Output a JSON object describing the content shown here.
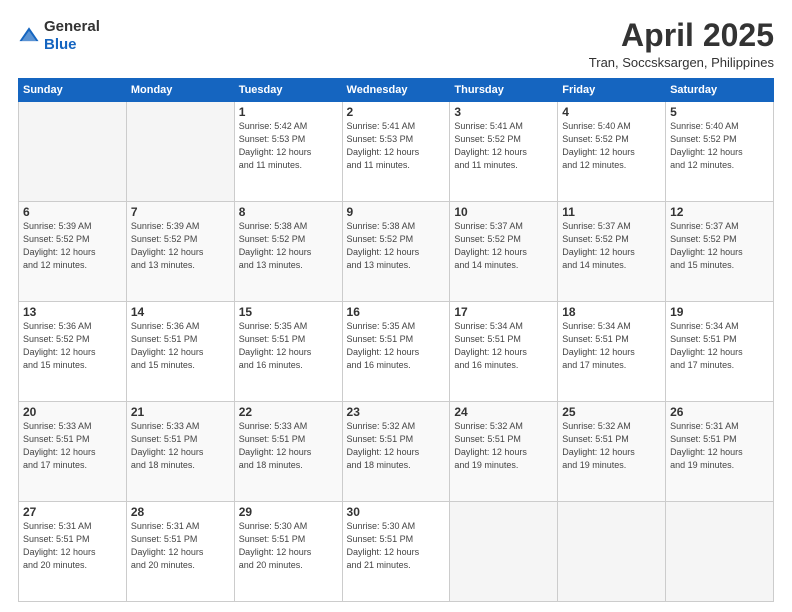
{
  "logo": {
    "general": "General",
    "blue": "Blue"
  },
  "title": "April 2025",
  "subtitle": "Tran, Soccsksargen, Philippines",
  "days_header": [
    "Sunday",
    "Monday",
    "Tuesday",
    "Wednesday",
    "Thursday",
    "Friday",
    "Saturday"
  ],
  "weeks": [
    [
      {
        "day": "",
        "info": ""
      },
      {
        "day": "",
        "info": ""
      },
      {
        "day": "1",
        "info": "Sunrise: 5:42 AM\nSunset: 5:53 PM\nDaylight: 12 hours\nand 11 minutes."
      },
      {
        "day": "2",
        "info": "Sunrise: 5:41 AM\nSunset: 5:53 PM\nDaylight: 12 hours\nand 11 minutes."
      },
      {
        "day": "3",
        "info": "Sunrise: 5:41 AM\nSunset: 5:52 PM\nDaylight: 12 hours\nand 11 minutes."
      },
      {
        "day": "4",
        "info": "Sunrise: 5:40 AM\nSunset: 5:52 PM\nDaylight: 12 hours\nand 12 minutes."
      },
      {
        "day": "5",
        "info": "Sunrise: 5:40 AM\nSunset: 5:52 PM\nDaylight: 12 hours\nand 12 minutes."
      }
    ],
    [
      {
        "day": "6",
        "info": "Sunrise: 5:39 AM\nSunset: 5:52 PM\nDaylight: 12 hours\nand 12 minutes."
      },
      {
        "day": "7",
        "info": "Sunrise: 5:39 AM\nSunset: 5:52 PM\nDaylight: 12 hours\nand 13 minutes."
      },
      {
        "day": "8",
        "info": "Sunrise: 5:38 AM\nSunset: 5:52 PM\nDaylight: 12 hours\nand 13 minutes."
      },
      {
        "day": "9",
        "info": "Sunrise: 5:38 AM\nSunset: 5:52 PM\nDaylight: 12 hours\nand 13 minutes."
      },
      {
        "day": "10",
        "info": "Sunrise: 5:37 AM\nSunset: 5:52 PM\nDaylight: 12 hours\nand 14 minutes."
      },
      {
        "day": "11",
        "info": "Sunrise: 5:37 AM\nSunset: 5:52 PM\nDaylight: 12 hours\nand 14 minutes."
      },
      {
        "day": "12",
        "info": "Sunrise: 5:37 AM\nSunset: 5:52 PM\nDaylight: 12 hours\nand 15 minutes."
      }
    ],
    [
      {
        "day": "13",
        "info": "Sunrise: 5:36 AM\nSunset: 5:52 PM\nDaylight: 12 hours\nand 15 minutes."
      },
      {
        "day": "14",
        "info": "Sunrise: 5:36 AM\nSunset: 5:51 PM\nDaylight: 12 hours\nand 15 minutes."
      },
      {
        "day": "15",
        "info": "Sunrise: 5:35 AM\nSunset: 5:51 PM\nDaylight: 12 hours\nand 16 minutes."
      },
      {
        "day": "16",
        "info": "Sunrise: 5:35 AM\nSunset: 5:51 PM\nDaylight: 12 hours\nand 16 minutes."
      },
      {
        "day": "17",
        "info": "Sunrise: 5:34 AM\nSunset: 5:51 PM\nDaylight: 12 hours\nand 16 minutes."
      },
      {
        "day": "18",
        "info": "Sunrise: 5:34 AM\nSunset: 5:51 PM\nDaylight: 12 hours\nand 17 minutes."
      },
      {
        "day": "19",
        "info": "Sunrise: 5:34 AM\nSunset: 5:51 PM\nDaylight: 12 hours\nand 17 minutes."
      }
    ],
    [
      {
        "day": "20",
        "info": "Sunrise: 5:33 AM\nSunset: 5:51 PM\nDaylight: 12 hours\nand 17 minutes."
      },
      {
        "day": "21",
        "info": "Sunrise: 5:33 AM\nSunset: 5:51 PM\nDaylight: 12 hours\nand 18 minutes."
      },
      {
        "day": "22",
        "info": "Sunrise: 5:33 AM\nSunset: 5:51 PM\nDaylight: 12 hours\nand 18 minutes."
      },
      {
        "day": "23",
        "info": "Sunrise: 5:32 AM\nSunset: 5:51 PM\nDaylight: 12 hours\nand 18 minutes."
      },
      {
        "day": "24",
        "info": "Sunrise: 5:32 AM\nSunset: 5:51 PM\nDaylight: 12 hours\nand 19 minutes."
      },
      {
        "day": "25",
        "info": "Sunrise: 5:32 AM\nSunset: 5:51 PM\nDaylight: 12 hours\nand 19 minutes."
      },
      {
        "day": "26",
        "info": "Sunrise: 5:31 AM\nSunset: 5:51 PM\nDaylight: 12 hours\nand 19 minutes."
      }
    ],
    [
      {
        "day": "27",
        "info": "Sunrise: 5:31 AM\nSunset: 5:51 PM\nDaylight: 12 hours\nand 20 minutes."
      },
      {
        "day": "28",
        "info": "Sunrise: 5:31 AM\nSunset: 5:51 PM\nDaylight: 12 hours\nand 20 minutes."
      },
      {
        "day": "29",
        "info": "Sunrise: 5:30 AM\nSunset: 5:51 PM\nDaylight: 12 hours\nand 20 minutes."
      },
      {
        "day": "30",
        "info": "Sunrise: 5:30 AM\nSunset: 5:51 PM\nDaylight: 12 hours\nand 21 minutes."
      },
      {
        "day": "",
        "info": ""
      },
      {
        "day": "",
        "info": ""
      },
      {
        "day": "",
        "info": ""
      }
    ]
  ]
}
